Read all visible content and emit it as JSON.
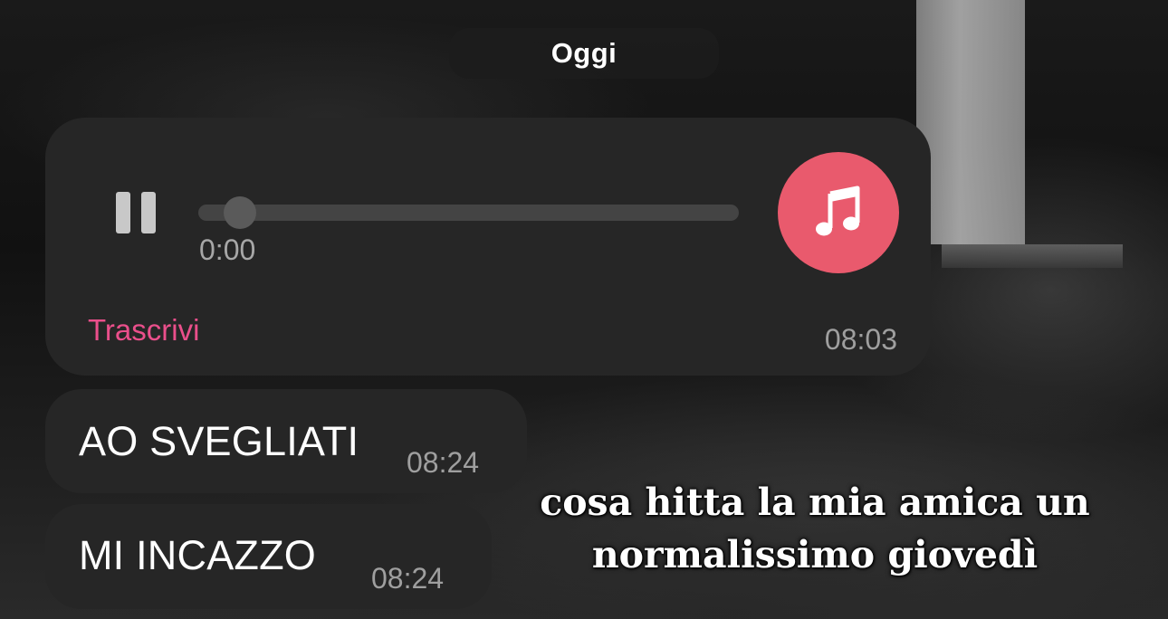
{
  "date_separator": {
    "label": "Oggi"
  },
  "audio_message": {
    "elapsed": "0:00",
    "progress": 0,
    "transcribe_label": "Trascrivi",
    "timestamp": "08:03",
    "state": "playing",
    "icon": "music-note-icon",
    "icon_color": "#e95a6d"
  },
  "messages": [
    {
      "text": "AO SVEGLIATI",
      "time": "08:24"
    },
    {
      "text": "MI INCAZZO",
      "time": "08:24"
    }
  ],
  "caption": {
    "line1": "cosa hitta la mia amica un",
    "line2": "normalissimo giovedì"
  },
  "colors": {
    "bubble": "#262626",
    "accent_link": "#ea4f8b",
    "timestamp": "#9f9f9f"
  }
}
